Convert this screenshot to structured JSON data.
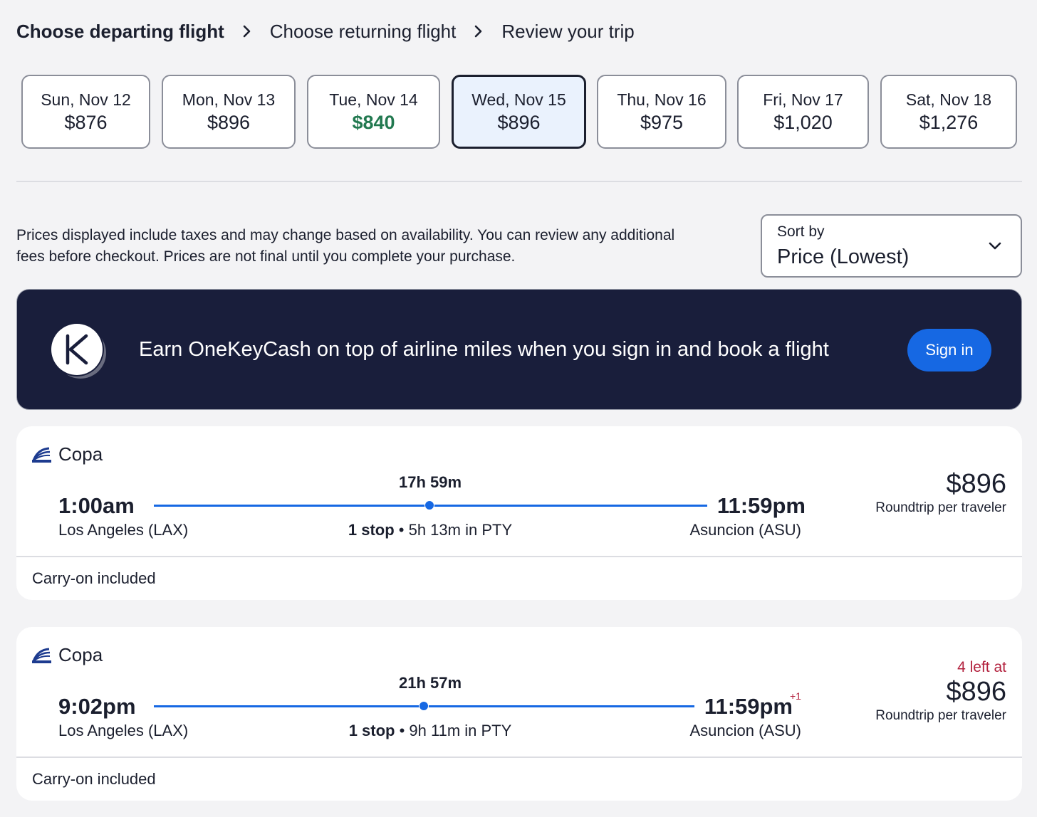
{
  "breadcrumb": {
    "steps": [
      "Choose departing flight",
      "Choose returning flight",
      "Review your trip"
    ]
  },
  "dates": [
    {
      "label": "Sun, Nov 12",
      "price": "$876"
    },
    {
      "label": "Mon, Nov 13",
      "price": "$896"
    },
    {
      "label": "Tue, Nov 14",
      "price": "$840"
    },
    {
      "label": "Wed, Nov 15",
      "price": "$896"
    },
    {
      "label": "Thu, Nov 16",
      "price": "$975"
    },
    {
      "label": "Fri, Nov 17",
      "price": "$1,020"
    },
    {
      "label": "Sat, Nov 18",
      "price": "$1,276"
    }
  ],
  "disclaimer": "Prices displayed include taxes and may change based on availability. You can review any additional fees before checkout. Prices are not final until you complete your purchase.",
  "sort": {
    "label": "Sort by",
    "value": "Price (Lowest)"
  },
  "banner": {
    "text": "Earn OneKeyCash on top of airline miles when you sign in and book a flight",
    "button": "Sign in"
  },
  "flights": [
    {
      "airline": "Copa",
      "depart_time": "1:00am",
      "depart_airport": "Los Angeles (LAX)",
      "arrive_time": "11:59pm",
      "arrive_airport": "Asuncion (ASU)",
      "duration": "17h 59m",
      "stops": "1 stop",
      "layover": " • 5h 13m in PTY",
      "price": "$896",
      "price_caption": "Roundtrip per traveler",
      "carry_on": "Carry-on included"
    },
    {
      "airline": "Copa",
      "depart_time": "9:02pm",
      "depart_airport": "Los Angeles (LAX)",
      "arrive_time": "11:59pm",
      "arrive_day_offset": "+1",
      "arrive_airport": "Asuncion (ASU)",
      "duration": "21h 57m",
      "stops": "1 stop",
      "layover": " • 9h 11m in PTY",
      "seats_left": "4 left at",
      "price": "$896",
      "price_caption": "Roundtrip per traveler",
      "carry_on": "Carry-on included"
    }
  ],
  "colors": {
    "accent": "#1668e3",
    "banner_bg": "#191e3b",
    "lowest_price": "#227950",
    "alert": "#b3233f"
  }
}
